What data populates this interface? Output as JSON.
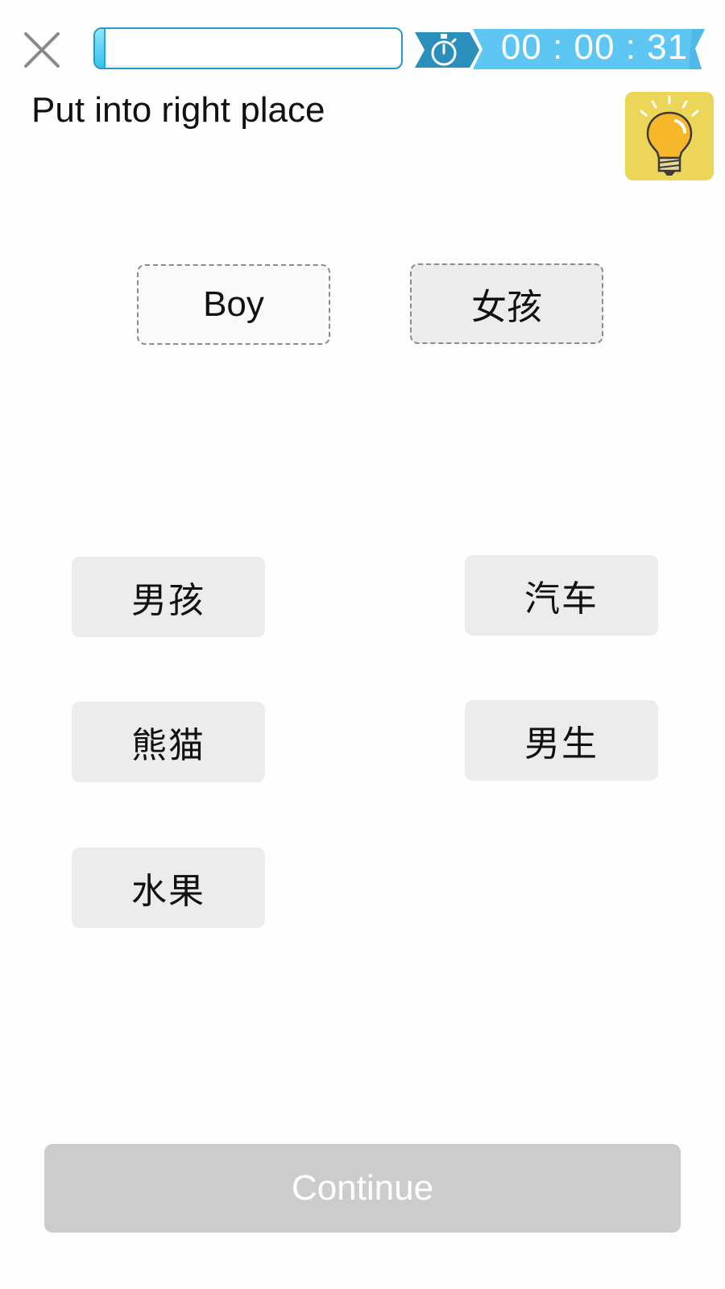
{
  "topbar": {
    "progress_fraction": 0.03,
    "timer_text": "00 : 00 : 31"
  },
  "instruction": "Put into right place",
  "slots": [
    {
      "text": "Boy"
    },
    {
      "text": "女孩"
    }
  ],
  "tiles": [
    {
      "text": "男孩"
    },
    {
      "text": "汽车"
    },
    {
      "text": "熊猫"
    },
    {
      "text": "男生"
    },
    {
      "text": "水果"
    }
  ],
  "continue_label": "Continue",
  "colors": {
    "timer_ribbon": "#5ec6f2",
    "timer_dark": "#2a8fbb",
    "hint_bg": "#ecd65a",
    "tile_bg": "#ececec",
    "continue_bg": "#cccccc"
  }
}
